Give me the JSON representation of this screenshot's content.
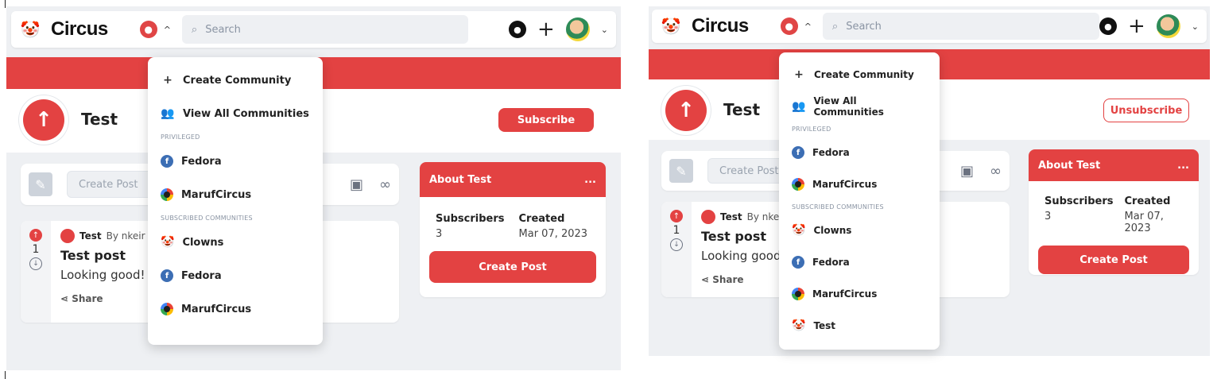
{
  "screens": [
    {
      "navbar": {
        "brand": "Circus",
        "search_placeholder": "Search",
        "community_caret": "^"
      },
      "community": {
        "title": "Test",
        "subscribe_label": "Subscribe"
      },
      "create_post": {
        "placeholder": "Create Post"
      },
      "post": {
        "community": "Test",
        "by": "By nkeir",
        "votes": "1",
        "title": "Test post",
        "text": "Looking good! -",
        "share": "Share"
      },
      "about": {
        "title": "About Test",
        "menu": "...",
        "subscribers_label": "Subscribers",
        "subscribers_value": "3",
        "created_label": "Created",
        "created_value": "Mar 07, 2023",
        "button": "Create Post"
      },
      "dropdown": {
        "create_community": "Create Community",
        "view_all": "View All Communities",
        "section_privileged": "PRIVILEGED",
        "privileged": [
          "Fedora",
          "MarufCircus"
        ],
        "section_subscribed": "SUBSCRIBED COMMUNITIES",
        "subscribed": [
          "Clowns",
          "Fedora",
          "MarufCircus"
        ]
      }
    },
    {
      "navbar": {
        "brand": "Circus",
        "search_placeholder": "Search",
        "community_caret": "^"
      },
      "community": {
        "title": "Test",
        "subscribe_label": "Unsubscribe"
      },
      "create_post": {
        "placeholder": "Create Post"
      },
      "post": {
        "community": "Test",
        "by": "By nkeir",
        "votes": "1",
        "title": "Test post",
        "text": "Looking good! -",
        "share": "Share"
      },
      "about": {
        "title": "About Test",
        "menu": "...",
        "subscribers_label": "Subscribers",
        "subscribers_value": "3",
        "created_label": "Created",
        "created_value": "Mar 07, 2023",
        "button": "Create Post"
      },
      "dropdown": {
        "create_community": "Create Community",
        "view_all": "View All Communities",
        "section_privileged": "PRIVILEGED",
        "privileged": [
          "Fedora",
          "MarufCircus"
        ],
        "section_subscribed": "SUBSCRIBED COMMUNITIES",
        "subscribed": [
          "Clowns",
          "Fedora",
          "MarufCircus",
          "Test"
        ]
      }
    }
  ],
  "icons": {
    "brand": "clown-icon",
    "community": "community-icon",
    "github": "github-icon",
    "plus": "plus-icon",
    "avatar": "user-avatar"
  },
  "colors": {
    "accent": "#e34242",
    "background": "#eef0f3"
  }
}
